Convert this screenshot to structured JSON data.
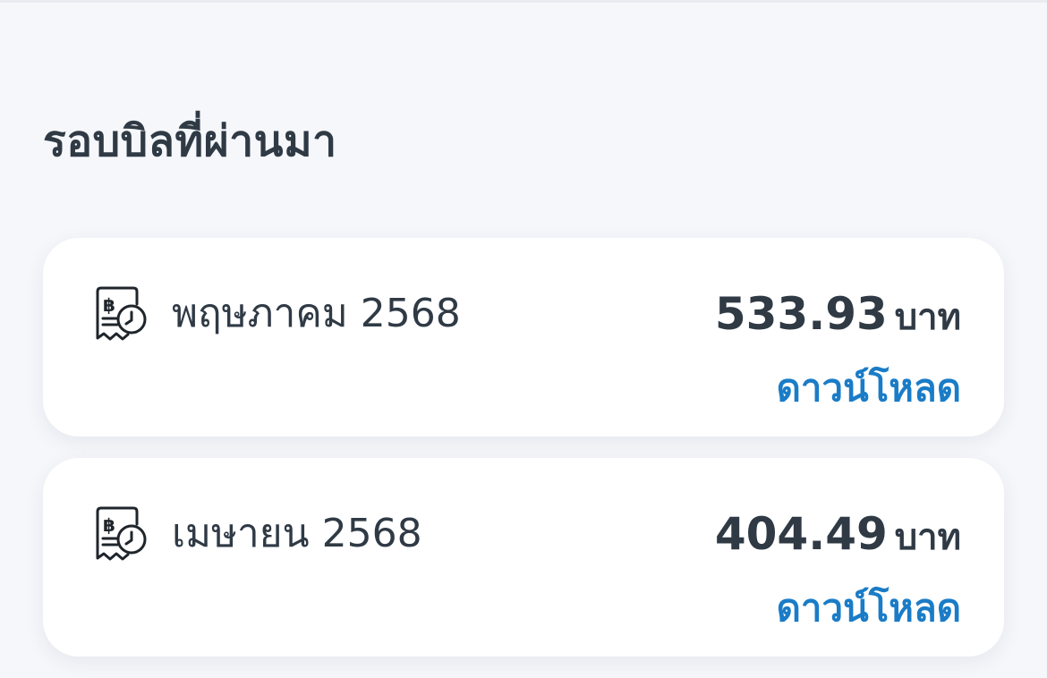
{
  "section": {
    "title": "รอบบิลที่ผ่านมา"
  },
  "bills": [
    {
      "period": "พฤษภาคม 2568",
      "amount": "533.93",
      "currency": "บาท",
      "download_label": "ดาวน์โหลด",
      "icon": "receipt-clock-icon"
    },
    {
      "period": "เมษายน 2568",
      "amount": "404.49",
      "currency": "บาท",
      "download_label": "ดาวน์โหลด",
      "icon": "receipt-clock-icon"
    }
  ],
  "colors": {
    "background": "#f6f7fb",
    "card": "#ffffff",
    "text": "#2f3a45",
    "link": "#1a7cc7"
  }
}
